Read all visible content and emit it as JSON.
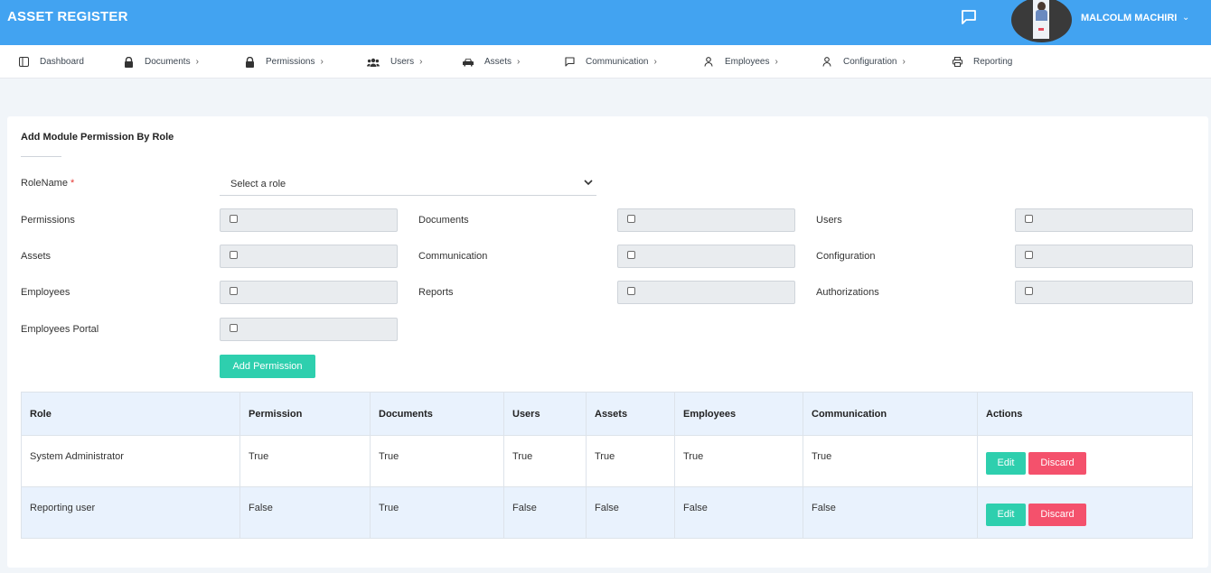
{
  "header": {
    "title": "ASSET REGISTER",
    "username": "MALCOLM MACHIRI"
  },
  "nav": [
    {
      "label": "Dashboard",
      "icon": "sidebar-panel-icon",
      "chevron": false
    },
    {
      "label": "Documents",
      "icon": "lock-icon",
      "chevron": true
    },
    {
      "label": "Permissions",
      "icon": "lock-icon",
      "chevron": true
    },
    {
      "label": "Users",
      "icon": "users-group-icon",
      "chevron": true
    },
    {
      "label": "Assets",
      "icon": "car-icon",
      "chevron": true
    },
    {
      "label": "Communication",
      "icon": "message-square-icon",
      "chevron": true
    },
    {
      "label": "Employees",
      "icon": "user-icon",
      "chevron": true
    },
    {
      "label": "Configuration",
      "icon": "user-icon",
      "chevron": true
    },
    {
      "label": "Reporting",
      "icon": "printer-icon",
      "chevron": false
    }
  ],
  "form": {
    "title": "Add Module Permission By Role",
    "role_label": "RoleName",
    "required_mark": "*",
    "role_placeholder": "Select a role",
    "permissions": [
      "Permissions",
      "Documents",
      "Users",
      "Assets",
      "Communication",
      "Configuration",
      "Employees",
      "Reports",
      "Authorizations",
      "Employees Portal"
    ],
    "add_button": "Add Permission"
  },
  "table": {
    "headers": [
      "Role",
      "Permission",
      "Documents",
      "Users",
      "Assets",
      "Employees",
      "Communication",
      "Actions"
    ],
    "rows": [
      [
        "System Administrator",
        "True",
        "True",
        "True",
        "True",
        "True",
        "True"
      ],
      [
        "Reporting user",
        "False",
        "True",
        "False",
        "False",
        "False",
        "False"
      ]
    ],
    "edit_label": "Edit",
    "discard_label": "Discard"
  },
  "colors": {
    "header_bg": "#42a3f1",
    "accent": "#2ecfae",
    "danger": "#f4516c",
    "table_header_bg": "#e9f2fd"
  }
}
